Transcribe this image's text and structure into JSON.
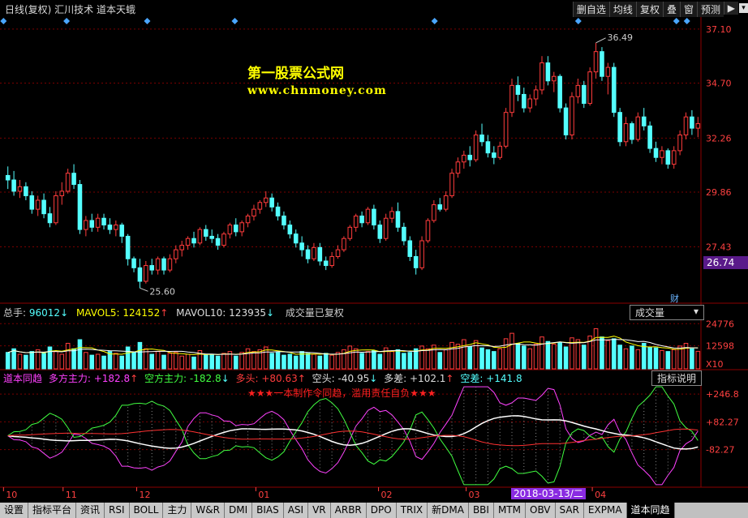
{
  "window": {
    "title": "日线(复权) 汇川技术 道本天蛾",
    "toolbar": [
      "删自选",
      "均线",
      "复权",
      "叠",
      "窗",
      "预测"
    ],
    "toolbar_arrow": "▶"
  },
  "watermark": {
    "line1": "第一股票公式网",
    "line2": "www.chnmoney.com"
  },
  "price_axis": {
    "labels": [
      "37.10",
      "34.70",
      "32.26",
      "29.86",
      "27.43"
    ],
    "current": "26.74",
    "fin_badge": "财"
  },
  "price_marks": {
    "high_label": "36.49",
    "low_label": "25.60"
  },
  "volume_header": {
    "total_label": "总手:",
    "total_value": "96012",
    "ma5_label": "MAVOL5:",
    "ma5_value": "124152",
    "ma10_label": "MAVOL10:",
    "ma10_value": "123935",
    "note": "成交量已复权",
    "dropdown": "成交量"
  },
  "volume_axis": {
    "labels": [
      "24776",
      "12598"
    ],
    "unit": "X10"
  },
  "indicator_header": {
    "name": "道本同趋",
    "bull_label": "多方主力:",
    "bull_value": "+182.8",
    "bear_label": "空方主力:",
    "bear_value": "-182.8",
    "long_label": "多头:",
    "long_value": "+80.63",
    "short_label": "空头:",
    "short_value": "-40.95",
    "diff_label": "多差:",
    "diff_value": "+102.1",
    "sdiff_label": "空差:",
    "sdiff_value": "+141.8",
    "help": "指标说明",
    "notice": "★★★一本制作令同趋，滥用责任自负★★★"
  },
  "indicator_axis": {
    "labels": [
      "+246.8",
      "+82.27",
      "-82.27"
    ]
  },
  "time_axis": {
    "labels": [
      "10",
      "11",
      "12",
      "01",
      "02",
      "03",
      "04"
    ],
    "cursor_date": "2018-03-13/二"
  },
  "bottom_tabs": [
    "设置",
    "指标平台",
    "资讯",
    "RSI",
    "BOLL",
    "主力",
    "W&R",
    "DMI",
    "BIAS",
    "ASI",
    "VR",
    "ARBR",
    "DPO",
    "TRIX",
    "新DMA",
    "BBI",
    "MTM",
    "OBV",
    "SAR",
    "EXPMA",
    "道本同趋"
  ],
  "colors": {
    "up": "#ff3c3c",
    "down": "#54ffff",
    "grid": "#8b0000",
    "axis_text": "#ff4040",
    "ma5": "#ffff00",
    "bull": "#ff40ff",
    "bear": "#40ff40"
  },
  "chart_data": {
    "type": "candlestick",
    "price_ylim": [
      25.0,
      37.6
    ],
    "candles": [
      [
        30.6,
        31.0,
        30.0,
        30.4
      ],
      [
        30.4,
        30.8,
        29.7,
        29.9
      ],
      [
        29.9,
        30.4,
        29.6,
        30.1
      ],
      [
        30.1,
        30.3,
        29.5,
        29.7
      ],
      [
        29.7,
        29.9,
        28.9,
        29.1
      ],
      [
        29.1,
        29.7,
        28.8,
        29.5
      ],
      [
        29.5,
        29.8,
        28.7,
        28.9
      ],
      [
        28.9,
        29.2,
        28.3,
        28.5
      ],
      [
        28.5,
        29.9,
        28.4,
        29.7
      ],
      [
        29.7,
        30.3,
        29.3,
        29.9
      ],
      [
        29.9,
        30.9,
        29.8,
        30.7
      ],
      [
        30.7,
        31.1,
        30.0,
        30.2
      ],
      [
        30.2,
        30.4,
        28.0,
        28.2
      ],
      [
        28.2,
        28.8,
        27.9,
        28.6
      ],
      [
        28.6,
        28.9,
        28.1,
        28.3
      ],
      [
        28.3,
        28.9,
        28.1,
        28.7
      ],
      [
        28.7,
        28.9,
        28.2,
        28.4
      ],
      [
        28.4,
        28.7,
        28.0,
        28.2
      ],
      [
        28.2,
        28.6,
        27.9,
        28.4
      ],
      [
        28.4,
        28.5,
        27.6,
        27.9
      ],
      [
        27.9,
        28.0,
        26.6,
        26.9
      ],
      [
        26.9,
        27.0,
        26.3,
        26.5
      ],
      [
        26.5,
        26.9,
        25.6,
        25.9
      ],
      [
        25.9,
        26.8,
        25.8,
        26.6
      ],
      [
        26.6,
        26.9,
        26.2,
        26.4
      ],
      [
        26.4,
        27.0,
        26.2,
        26.9
      ],
      [
        26.9,
        27.0,
        26.2,
        26.4
      ],
      [
        26.4,
        27.1,
        26.3,
        26.9
      ],
      [
        26.9,
        27.5,
        26.7,
        27.3
      ],
      [
        27.3,
        27.7,
        27.0,
        27.5
      ],
      [
        27.5,
        27.9,
        27.3,
        27.8
      ],
      [
        27.8,
        28.1,
        27.4,
        27.6
      ],
      [
        27.6,
        28.3,
        27.5,
        28.2
      ],
      [
        28.2,
        28.4,
        27.7,
        27.9
      ],
      [
        27.9,
        28.2,
        27.6,
        27.8
      ],
      [
        27.8,
        28.0,
        27.3,
        27.5
      ],
      [
        27.5,
        28.1,
        27.4,
        28.0
      ],
      [
        28.0,
        28.5,
        27.8,
        28.4
      ],
      [
        28.4,
        28.7,
        27.9,
        28.1
      ],
      [
        28.1,
        28.6,
        27.9,
        28.5
      ],
      [
        28.5,
        28.9,
        28.3,
        28.8
      ],
      [
        28.8,
        29.3,
        28.6,
        29.1
      ],
      [
        29.1,
        29.5,
        28.9,
        29.4
      ],
      [
        29.4,
        29.9,
        29.2,
        29.6
      ],
      [
        29.6,
        29.8,
        29.0,
        29.2
      ],
      [
        29.2,
        29.4,
        28.6,
        28.8
      ],
      [
        28.8,
        29.0,
        28.2,
        28.4
      ],
      [
        28.4,
        28.6,
        27.8,
        28.0
      ],
      [
        28.0,
        28.2,
        27.4,
        27.6
      ],
      [
        27.6,
        27.9,
        27.0,
        27.3
      ],
      [
        27.3,
        27.5,
        26.7,
        26.9
      ],
      [
        26.9,
        27.6,
        26.8,
        27.4
      ],
      [
        27.4,
        27.6,
        26.6,
        26.8
      ],
      [
        26.8,
        27.0,
        26.4,
        26.6
      ],
      [
        26.6,
        27.2,
        26.5,
        27.0
      ],
      [
        27.0,
        27.5,
        26.9,
        27.3
      ],
      [
        27.3,
        27.9,
        27.2,
        27.8
      ],
      [
        27.8,
        28.4,
        27.7,
        28.3
      ],
      [
        28.3,
        28.9,
        28.1,
        28.8
      ],
      [
        28.8,
        29.0,
        28.3,
        28.5
      ],
      [
        28.5,
        29.2,
        28.4,
        29.1
      ],
      [
        29.1,
        29.3,
        28.2,
        28.4
      ],
      [
        28.4,
        28.6,
        27.6,
        27.8
      ],
      [
        27.8,
        28.9,
        27.7,
        28.7
      ],
      [
        28.7,
        29.2,
        28.5,
        29.0
      ],
      [
        29.0,
        29.4,
        28.1,
        28.3
      ],
      [
        28.3,
        28.5,
        27.5,
        27.7
      ],
      [
        27.7,
        27.9,
        26.8,
        27.0
      ],
      [
        27.0,
        27.3,
        26.2,
        26.5
      ],
      [
        26.5,
        27.9,
        26.4,
        27.7
      ],
      [
        27.7,
        28.7,
        27.6,
        28.6
      ],
      [
        28.6,
        29.5,
        28.5,
        29.3
      ],
      [
        29.3,
        29.6,
        29.0,
        29.1
      ],
      [
        29.1,
        29.9,
        29.0,
        29.7
      ],
      [
        29.7,
        30.9,
        29.6,
        30.7
      ],
      [
        30.7,
        31.4,
        30.5,
        31.2
      ],
      [
        31.2,
        31.7,
        30.9,
        31.5
      ],
      [
        31.5,
        31.9,
        31.0,
        31.3
      ],
      [
        31.3,
        32.6,
        31.2,
        32.4
      ],
      [
        32.4,
        32.9,
        31.9,
        32.1
      ],
      [
        32.1,
        32.4,
        31.4,
        31.6
      ],
      [
        31.6,
        31.9,
        31.1,
        31.4
      ],
      [
        31.4,
        32.1,
        31.3,
        31.9
      ],
      [
        31.9,
        33.6,
        31.8,
        33.4
      ],
      [
        33.4,
        34.9,
        33.2,
        34.6
      ],
      [
        34.6,
        35.0,
        33.9,
        34.2
      ],
      [
        34.2,
        34.5,
        33.4,
        33.6
      ],
      [
        33.6,
        34.2,
        33.4,
        34.0
      ],
      [
        34.0,
        34.6,
        33.7,
        34.4
      ],
      [
        34.4,
        35.9,
        34.2,
        35.6
      ],
      [
        35.6,
        35.9,
        34.6,
        34.8
      ],
      [
        34.8,
        35.2,
        34.3,
        35.0
      ],
      [
        35.0,
        35.1,
        33.4,
        33.6
      ],
      [
        33.6,
        33.8,
        32.2,
        32.4
      ],
      [
        32.4,
        34.3,
        32.2,
        34.1
      ],
      [
        34.1,
        34.9,
        33.8,
        34.6
      ],
      [
        34.6,
        34.8,
        33.6,
        33.8
      ],
      [
        33.8,
        35.4,
        33.7,
        35.2
      ],
      [
        35.2,
        36.49,
        34.9,
        36.1
      ],
      [
        36.1,
        36.3,
        34.8,
        35.0
      ],
      [
        35.0,
        35.6,
        34.2,
        35.4
      ],
      [
        35.4,
        35.6,
        33.2,
        33.4
      ],
      [
        33.4,
        33.6,
        31.9,
        32.1
      ],
      [
        32.1,
        33.2,
        31.9,
        32.9
      ],
      [
        32.9,
        33.0,
        32.0,
        32.2
      ],
      [
        32.2,
        33.4,
        32.1,
        33.2
      ],
      [
        33.2,
        33.6,
        32.6,
        32.8
      ],
      [
        32.8,
        33.0,
        31.6,
        31.8
      ],
      [
        31.8,
        32.1,
        31.2,
        31.4
      ],
      [
        31.4,
        31.9,
        31.1,
        31.7
      ],
      [
        31.7,
        31.8,
        30.9,
        31.1
      ],
      [
        31.1,
        31.9,
        30.9,
        31.7
      ],
      [
        31.7,
        32.6,
        31.5,
        32.4
      ],
      [
        32.4,
        33.4,
        32.2,
        33.2
      ],
      [
        33.2,
        33.5,
        32.4,
        32.7
      ],
      [
        32.7,
        33.2,
        32.3,
        32.9
      ]
    ],
    "volume_ylim": [
      0,
      28000
    ],
    "volumes": [
      9000,
      11000,
      8000,
      7500,
      9500,
      10500,
      8500,
      12000,
      9500,
      8000,
      14000,
      11000,
      16000,
      9000,
      7500,
      8000,
      7000,
      9500,
      8500,
      7000,
      12000,
      9000,
      14500,
      11000,
      8000,
      9500,
      7500,
      8500,
      9000,
      7000,
      8000,
      6500,
      10000,
      7500,
      8000,
      7000,
      8500,
      9500,
      7000,
      9000,
      11000,
      9500,
      10500,
      12000,
      8500,
      9000,
      7500,
      8000,
      7000,
      9500,
      8500,
      8000,
      7000,
      8500,
      7500,
      9000,
      10500,
      12500,
      11000,
      8500,
      9500,
      10000,
      8000,
      11500,
      9500,
      10500,
      8500,
      9000,
      11000,
      12500,
      11000,
      13000,
      9000,
      10500,
      14500,
      13500,
      16000,
      12000,
      15500,
      11500,
      10500,
      9500,
      11000,
      16500,
      19500,
      14000,
      12500,
      11000,
      13500,
      17500,
      15000,
      13500,
      14500,
      12000,
      17000,
      16000,
      13000,
      18000,
      22000,
      17500,
      15500,
      16500,
      13000,
      11000,
      12500,
      10500,
      14000,
      12000,
      11500,
      10000,
      9500,
      10500,
      12500,
      14000,
      11000,
      9601
    ],
    "indicator_ylim": [
      -300,
      300
    ],
    "indicator_series": [
      {
        "name": "多方主力",
        "color": "#ff40ff"
      },
      {
        "name": "空方主力",
        "color": "#40ff40"
      }
    ]
  }
}
